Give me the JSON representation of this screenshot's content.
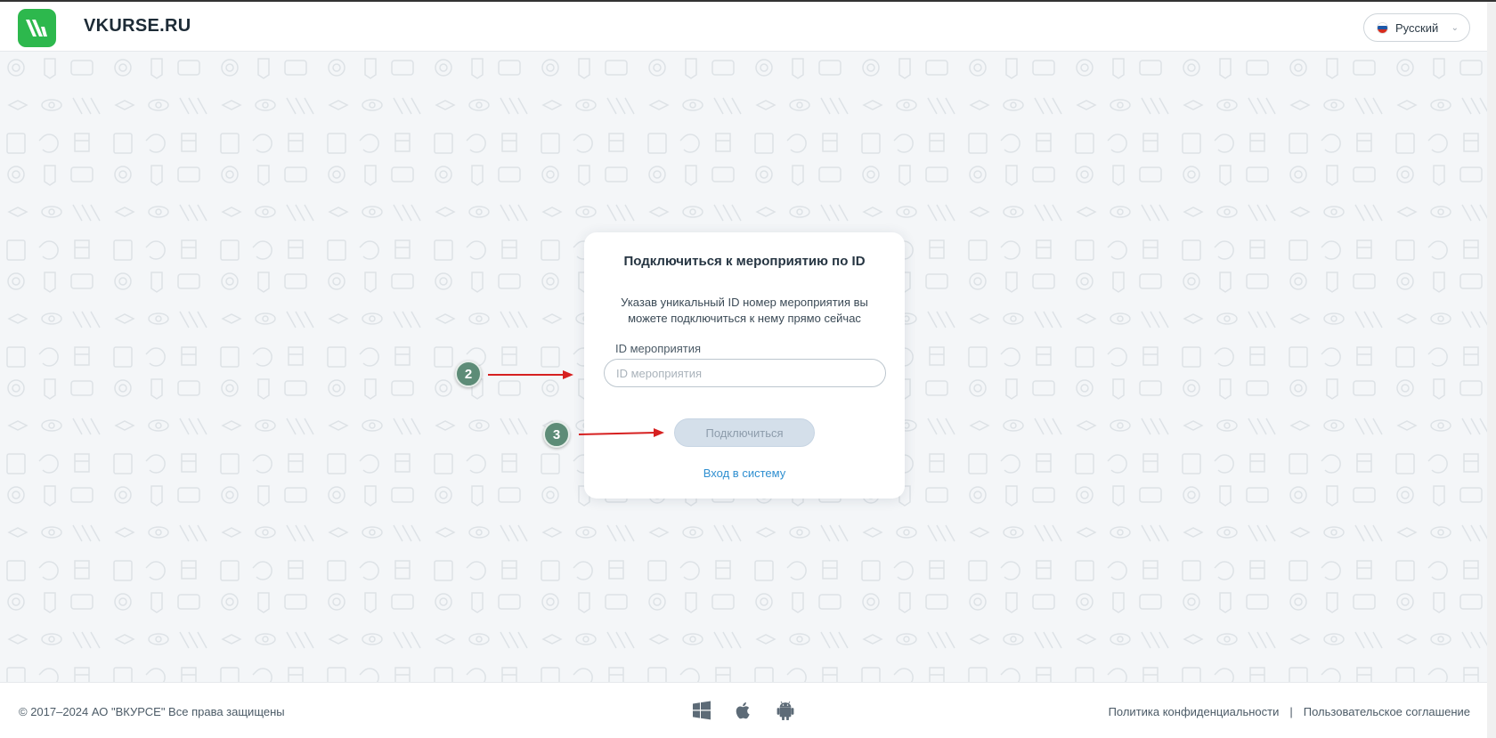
{
  "header": {
    "brand": "VKURSE.RU",
    "language": "Русский"
  },
  "card": {
    "title": "Подключиться к мероприятию по ID",
    "description": "Указав уникальный ID номер мероприятия вы можете подключиться к нему прямо сейчас",
    "field_label": "ID мероприятия",
    "field_placeholder": "ID мероприятия",
    "field_value": "",
    "connect_label": "Подключиться",
    "login_link": "Вход в систему"
  },
  "annotations": {
    "step2": "2",
    "step3": "3"
  },
  "footer": {
    "copyright": "© 2017–2024 АО \"ВКУРСЕ\" Все права защищены",
    "privacy": "Политика конфиденциальности",
    "separator": "|",
    "terms": "Пользовательское соглашение",
    "platform_icons": [
      "windows-icon",
      "apple-icon",
      "android-icon"
    ]
  },
  "colors": {
    "brand_green": "#2db84d",
    "link_blue": "#2f8fd0",
    "button_disabled": "#d4dfea",
    "annotation_green": "#5d8c77",
    "annotation_arrow": "#d62020"
  }
}
